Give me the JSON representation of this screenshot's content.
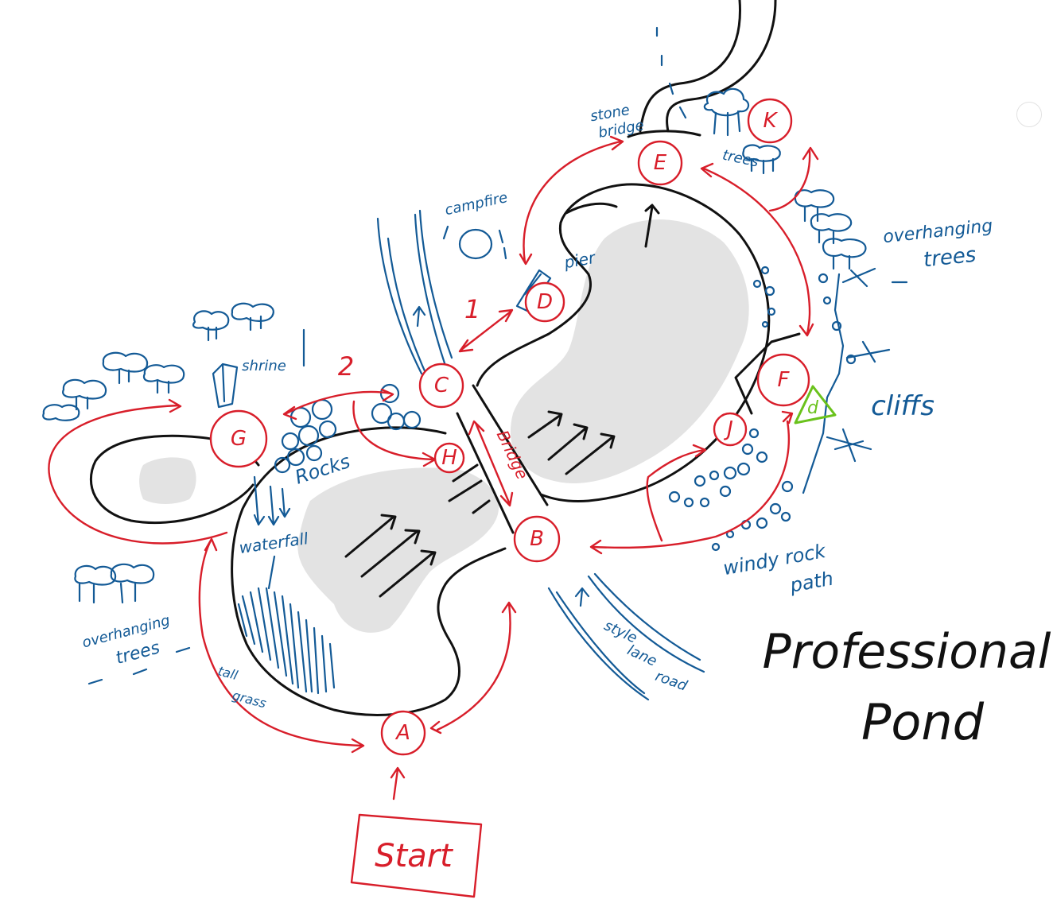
{
  "colors": {
    "route": "#d81e2a",
    "features": "#135a96",
    "outline": "#111111",
    "water": "#e3e3e3",
    "marker": "#6ac21c"
  },
  "title": {
    "line1": "Professional",
    "line2": "Pond"
  },
  "start_label": "Start",
  "nodes": [
    "A",
    "B",
    "C",
    "D",
    "E",
    "F",
    "G",
    "H",
    "J",
    "K"
  ],
  "marker_label": "d",
  "route_numbers": [
    "1",
    "2"
  ],
  "labels": {
    "stone_bridge": [
      "stone",
      "bridge"
    ],
    "trees": "trees",
    "campfire": "campfire",
    "pier": "pier",
    "overhanging_trees_right": [
      "overhanging",
      "trees"
    ],
    "cliffs": "cliffs",
    "windy_rock_path": [
      "windy rock",
      "path"
    ],
    "style_lane_road": [
      "style",
      "lane",
      "road"
    ],
    "bridge": "Bridge",
    "shrine": "shrine",
    "rocks": "Rocks",
    "waterfall": "waterfall",
    "overhanging_trees_left": [
      "overhanging",
      "trees"
    ],
    "tall_grass": [
      "tall",
      "grass"
    ]
  }
}
